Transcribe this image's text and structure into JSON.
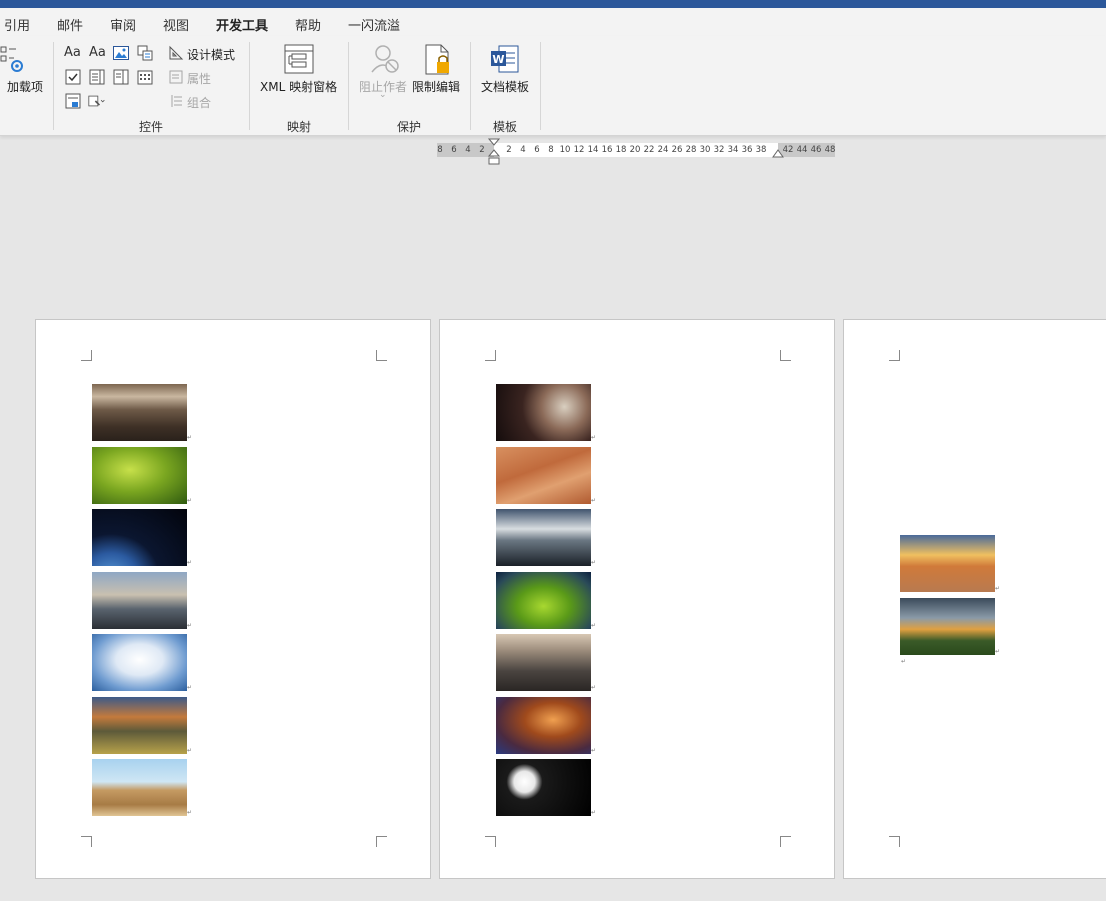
{
  "ribbon_tabs": [
    "引用",
    "邮件",
    "审阅",
    "视图",
    "开发工具",
    "帮助",
    "一闪流溢"
  ],
  "active_tab": "开发工具",
  "ribbon": {
    "addins_label": "加载项",
    "controls": {
      "design_mode": "设计模式",
      "properties": "属性",
      "group": "组合",
      "group_label": "控件",
      "aa1": "Aa",
      "aa2": "Aa"
    },
    "mapping": {
      "xml_pane": "XML 映射窗格",
      "group_label": "映射"
    },
    "protect": {
      "block_authors": "阻止作者",
      "restrict_editing": "限制编辑",
      "group_label": "保护"
    },
    "templates": {
      "doc_template": "文档模板",
      "group_label": "模板"
    }
  },
  "ruler": {
    "numbers": [
      "8",
      "6",
      "4",
      "2",
      "2",
      "4",
      "6",
      "8",
      "10",
      "12",
      "14",
      "16",
      "18",
      "20",
      "22",
      "24",
      "26",
      "28",
      "30",
      "32",
      "34",
      "36",
      "38",
      "42",
      "44",
      "46",
      "48"
    ]
  },
  "pages": [
    {
      "images": [
        "cracked-earth",
        "green-leaves",
        "earth-from-space",
        "city-skyline",
        "cumulus-clouds",
        "storm-over-field",
        "pyramids"
      ]
    },
    {
      "images": [
        "planet-space",
        "desert-dunes",
        "pier-sunset",
        "green-creature",
        "city-aerial",
        "nebula",
        "white-flowers"
      ]
    },
    {
      "images": [
        "beach-sunset",
        "stormy-meadow"
      ]
    }
  ],
  "colors": {
    "accent": "#2b579a",
    "canvas": "#e6e6e6",
    "ribbon": "#f3f3f3"
  }
}
